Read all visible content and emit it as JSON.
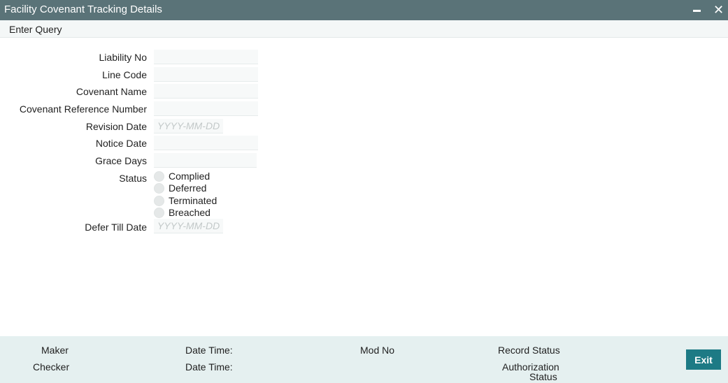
{
  "window": {
    "title": "Facility Covenant Tracking Details",
    "minimize_icon": "minimize-icon",
    "close_icon": "close-icon",
    "close_glyph": "✕"
  },
  "toolbar": {
    "enter_query": "Enter Query"
  },
  "form": {
    "liability_no": {
      "label": "Liability No",
      "value": ""
    },
    "line_code": {
      "label": "Line Code",
      "value": ""
    },
    "covenant_name": {
      "label": "Covenant Name",
      "value": ""
    },
    "covenant_reference_number": {
      "label": "Covenant Reference Number",
      "value": ""
    },
    "revision_date": {
      "label": "Revision Date",
      "placeholder": "YYYY-MM-DD"
    },
    "notice_date": {
      "label": "Notice Date",
      "value": ""
    },
    "grace_days": {
      "label": "Grace Days",
      "value": ""
    },
    "status": {
      "label": "Status",
      "options": [
        "Complied",
        "Deferred",
        "Terminated",
        "Breached"
      ],
      "selected": null
    },
    "defer_till_date": {
      "label": "Defer Till Date",
      "placeholder": "YYYY-MM-DD"
    }
  },
  "footer": {
    "maker": "Maker",
    "checker": "Checker",
    "date_time_1": "Date Time:",
    "date_time_2": "Date Time:",
    "mod_no": "Mod No",
    "record_status": "Record Status",
    "authorization_status_line1": "Authorization",
    "authorization_status_line2": "Status",
    "exit_label": "Exit"
  },
  "colors": {
    "titlebar": "#5a7378",
    "footer": "#e5f0f0",
    "exit_button": "#1d7a85"
  }
}
